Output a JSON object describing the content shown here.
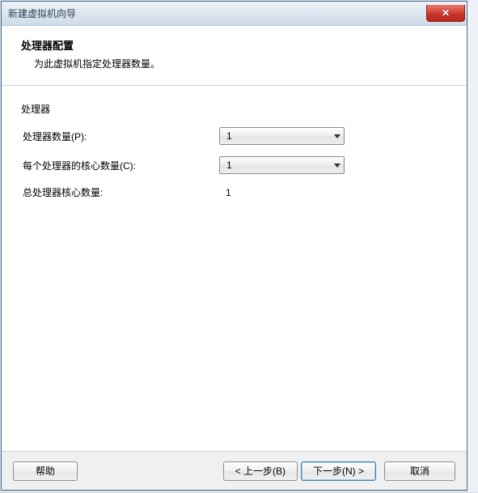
{
  "window": {
    "title": "新建虚拟机向导"
  },
  "header": {
    "title": "处理器配置",
    "subtitle": "为此虚拟机指定处理器数量。"
  },
  "form": {
    "group_label": "处理器",
    "processor_count": {
      "label": "处理器数量(P):",
      "value": "1"
    },
    "cores_per_processor": {
      "label": "每个处理器的核心数量(C):",
      "value": "1"
    },
    "total_cores": {
      "label": "总处理器核心数量:",
      "value": "1"
    }
  },
  "buttons": {
    "help": "帮助",
    "back": "< 上一步(B)",
    "next": "下一步(N) >",
    "cancel": "取消"
  }
}
